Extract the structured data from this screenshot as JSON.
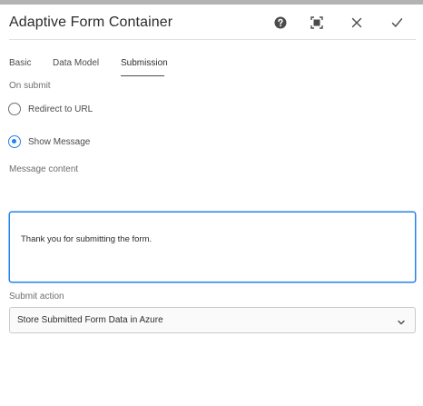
{
  "dialog": {
    "title": "Adaptive Form Container",
    "help_icon": "help-icon",
    "fullscreen_icon": "fullscreen-icon",
    "close_icon": "close-icon",
    "done_icon": "checkmark-icon"
  },
  "tabs": [
    {
      "label": "Basic",
      "selected": false
    },
    {
      "label": "Data Model",
      "selected": false
    },
    {
      "label": "Submission",
      "selected": true
    }
  ],
  "on_submit": {
    "label": "On submit",
    "options": [
      {
        "label": "Redirect to URL",
        "checked": false
      },
      {
        "label": "Show Message",
        "checked": true
      }
    ]
  },
  "message_content": {
    "label": "Message content",
    "value": "Thank you for submitting the form."
  },
  "submit_action": {
    "label": "Submit action",
    "selected": "Store Submitted Form Data in Azure"
  },
  "colors": {
    "accent": "#2680eb",
    "text": "#4b4b4b",
    "border": "#cacaca"
  }
}
